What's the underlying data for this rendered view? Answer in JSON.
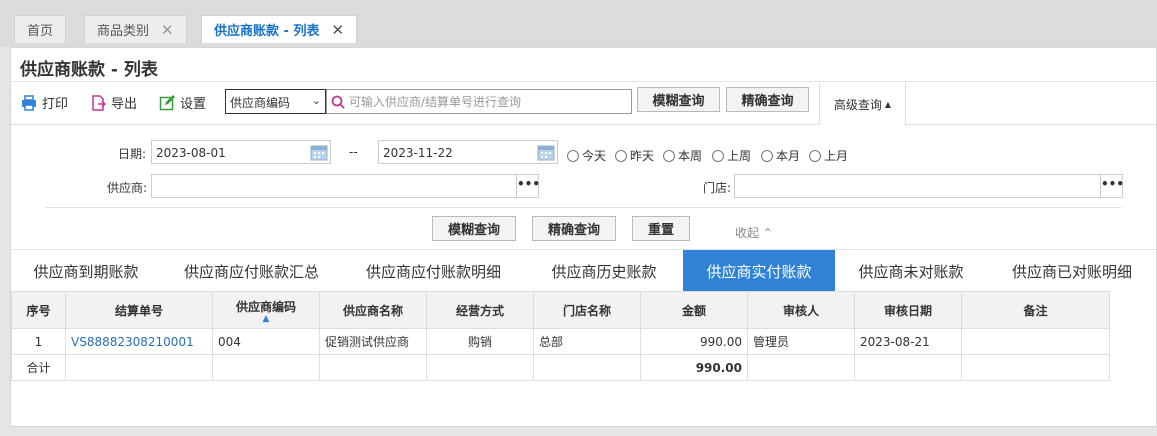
{
  "tabs": [
    {
      "label": "首页"
    },
    {
      "label": "商品类别"
    },
    {
      "label": "供应商账款 - 列表"
    }
  ],
  "page_title": "供应商账款 - 列表",
  "toolbar": {
    "print": "打印",
    "export": "导出",
    "settings": "设置",
    "field_select": "供应商编码",
    "search_placeholder": "可输入供应商/结算单号进行查询",
    "fuzzy": "模糊查询",
    "exact": "精确查询",
    "advanced": "高级查询"
  },
  "filters": {
    "date_label": "日期:",
    "date_from": "2023-08-01",
    "date_sep": "--",
    "date_to": "2023-11-22",
    "quick_ranges": [
      "今天",
      "昨天",
      "本周",
      "上周",
      "本月",
      "上月"
    ],
    "supplier_label": "供应商:",
    "store_label": "门店:",
    "dots": "•••",
    "fuzzy": "模糊查询",
    "exact": "精确查询",
    "reset": "重置",
    "collapse": "收起"
  },
  "report_tabs": [
    "供应商到期账款",
    "供应商应付账款汇总",
    "供应商应付账款明细",
    "供应商历史账款",
    "供应商实付账款",
    "供应商未对账款",
    "供应商已对账明细"
  ],
  "active_report_tab": "供应商实付账款",
  "table": {
    "headers": [
      "序号",
      "结算单号",
      "供应商编码",
      "供应商名称",
      "经营方式",
      "门店名称",
      "金额",
      "审核人",
      "审核日期",
      "备注"
    ],
    "rows": [
      [
        "1",
        "VS88882308210001",
        "004",
        "促销测试供应商",
        "购销",
        "总部",
        "990.00",
        "管理员",
        "2023-08-21",
        ""
      ]
    ],
    "total": [
      "合计",
      "",
      "",
      "",
      "",
      "",
      "990.00",
      "",
      "",
      ""
    ]
  }
}
